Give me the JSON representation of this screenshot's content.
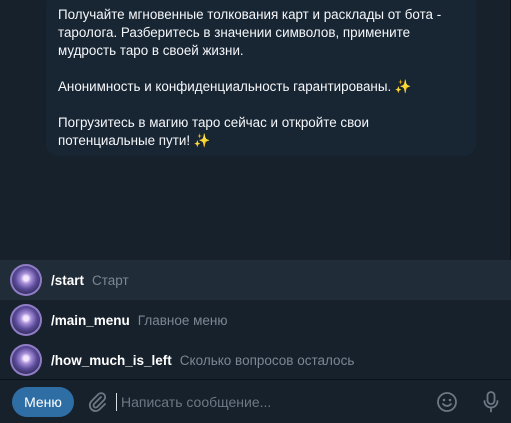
{
  "message": {
    "paragraph1": "Получайте мгновенные толкования карт и расклады от бота - таролога. Разберитесь в значении символов, примените мудрость таро в своей жизни.",
    "paragraph2": "Анонимность и конфиденциальность гарантированы.",
    "paragraph3": "Погрузитесь в магию таро сейчас и откройте свои потенциальные пути!",
    "emoji": "✨"
  },
  "commands": [
    {
      "name": "/start",
      "desc": "Старт"
    },
    {
      "name": "/main_menu",
      "desc": "Главное меню"
    },
    {
      "name": "/how_much_is_left",
      "desc": "Сколько вопросов осталось"
    }
  ],
  "input": {
    "menu_label": "Меню",
    "placeholder": "Написать сообщение..."
  },
  "colors": {
    "accent": "#2f6ea5",
    "background": "#17212b",
    "bubble": "#182533"
  }
}
